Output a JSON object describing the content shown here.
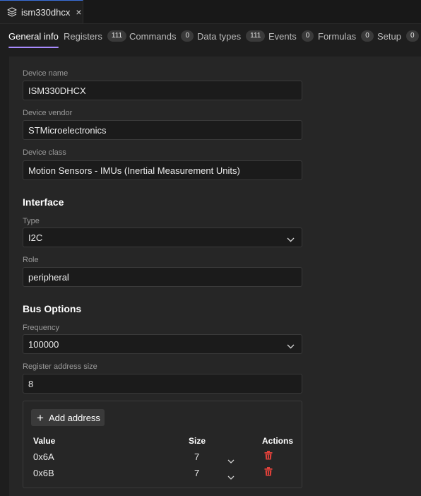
{
  "editor_tab": {
    "title": "ism330dhcx",
    "icon": "layers-icon",
    "close": "×"
  },
  "nav_tabs": [
    {
      "label": "General info",
      "count": null,
      "active": true
    },
    {
      "label": "Registers",
      "count": "111"
    },
    {
      "label": "Commands",
      "count": "0"
    },
    {
      "label": "Data types",
      "count": "111"
    },
    {
      "label": "Events",
      "count": "0"
    },
    {
      "label": "Formulas",
      "count": "0"
    },
    {
      "label": "Setup",
      "count": "0"
    }
  ],
  "general": {
    "device_name_label": "Device name",
    "device_name": "ISM330DHCX",
    "device_vendor_label": "Device vendor",
    "device_vendor": "STMicroelectronics",
    "device_class_label": "Device class",
    "device_class": "Motion Sensors - IMUs (Inertial Measurement Units)"
  },
  "interface": {
    "title": "Interface",
    "type_label": "Type",
    "type_value": "I2C",
    "role_label": "Role",
    "role_value": "peripheral"
  },
  "bus": {
    "title": "Bus Options",
    "frequency_label": "Frequency",
    "frequency_value": "100000",
    "reg_addr_size_label": "Register address size",
    "reg_addr_size_value": "8"
  },
  "addresses": {
    "add_label": "Add address",
    "columns": {
      "value": "Value",
      "size": "Size",
      "actions": "Actions"
    },
    "rows": [
      {
        "value": "0x6A",
        "size": "7"
      },
      {
        "value": "0x6B",
        "size": "7"
      }
    ]
  },
  "colors": {
    "accent": "#a98bff",
    "delete": "#e0413a",
    "background": "#1e1e1e"
  }
}
